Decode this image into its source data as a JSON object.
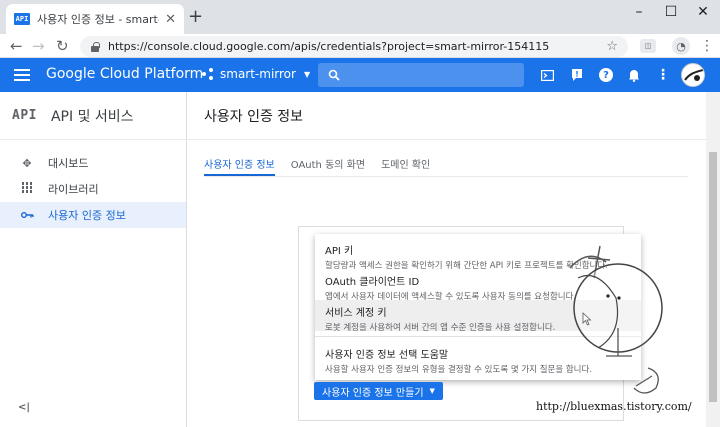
{
  "browser": {
    "tab_title": "사용자 인증 정보 - smart-mirror",
    "tab_favicon": "API",
    "new_tab": "+",
    "url": "https://console.cloud.google.com/apis/credentials?project=smart-mirror-154115",
    "window_controls": [
      "minimize-icon",
      "maximize-icon",
      "close-icon"
    ]
  },
  "header": {
    "brand": "Google Cloud Platform",
    "project": "smart-mirror",
    "accent": "#1a73e8"
  },
  "sidebar": {
    "logo": "API",
    "title": "API 및 서비스",
    "items": [
      {
        "label": "대시보드",
        "icon": "dashboard-icon"
      },
      {
        "label": "라이브러리",
        "icon": "library-icon"
      },
      {
        "label": "사용자 인증 정보",
        "icon": "key-icon",
        "active": true
      }
    ],
    "collapse": "<|"
  },
  "main": {
    "title": "사용자 인증 정보",
    "tabs": [
      {
        "label": "사용자 인증 정보",
        "active": true
      },
      {
        "label": "OAuth 동의 화면"
      },
      {
        "label": "도메인 확인"
      }
    ]
  },
  "menu": {
    "items": [
      {
        "title": "API 키",
        "desc": "할당량과 액세스 권한을 확인하기 위해 간단한 API 키로 프로젝트를 확인합니다."
      },
      {
        "title": "OAuth 클라이언트 ID",
        "desc": "앱에서 사용자 데이터에 액세스할 수 있도록 사용자 동의를 요청합니다."
      },
      {
        "title": "서비스 계정 키",
        "desc": "로봇 계정을 사용하여 서버 간의 앱 수준 인증을 사용 설정합니다.",
        "hover": true
      },
      {
        "title": "사용자 인증 정보 선택 도움말",
        "desc": "사용할 사용자 인증 정보의 유형을 결정할 수 있도록 몇 가지 질문을 합니다."
      }
    ]
  },
  "create_button": "사용자 인증 정보 만들기",
  "watermark": "http://bluexmas.tistory.com/"
}
